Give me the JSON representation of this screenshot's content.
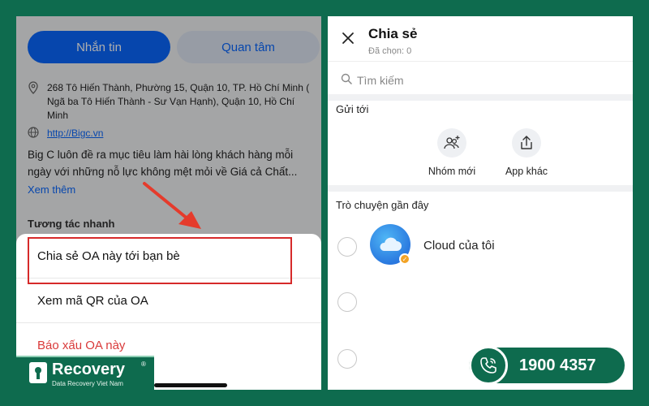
{
  "left_panel": {
    "buttons": {
      "message": "Nhắn tin",
      "follow": "Quan tâm"
    },
    "address": "268 Tô Hiến Thành, Phường 15, Quận 10, TP. Hồ Chí Minh ( Ngã ba Tô Hiến Thành - Sư Vạn Hạnh), Quận 10, Hồ Chí Minh",
    "website": "http://Bigc.vn",
    "description": "Big C luôn đề ra mục tiêu làm hài lòng khách hàng mỗi ngày với những nỗ lực không mệt mỏi về Giá cả Chất...",
    "see_more": "Xem thêm",
    "quick_actions_title": "Tương tác nhanh",
    "sheet": {
      "share": "Chia sẻ OA này tới bạn bè",
      "qr": "Xem mã QR của OA",
      "report": "Báo xấu OA này"
    }
  },
  "right_panel": {
    "title": "Chia sẻ",
    "selected": "Đã chọn: 0",
    "search_placeholder": "Tìm kiếm",
    "send_to": "Gửi tới",
    "new_group": "Nhóm mới",
    "other_app": "App khác",
    "recent_chats_title": "Trò chuyện gần đây",
    "recent_chats": [
      {
        "name": "Cloud của tôi"
      }
    ]
  },
  "branding": {
    "logo_text": "Recovery",
    "logo_reg": "®",
    "logo_sub": "Data Recovery Viet Nam",
    "hotline": "1900 4357"
  },
  "colors": {
    "frame": "#0e6b4e",
    "accent_blue": "#0a68ff",
    "highlight_red": "#d62a2a",
    "danger_red": "#d93a3a"
  }
}
